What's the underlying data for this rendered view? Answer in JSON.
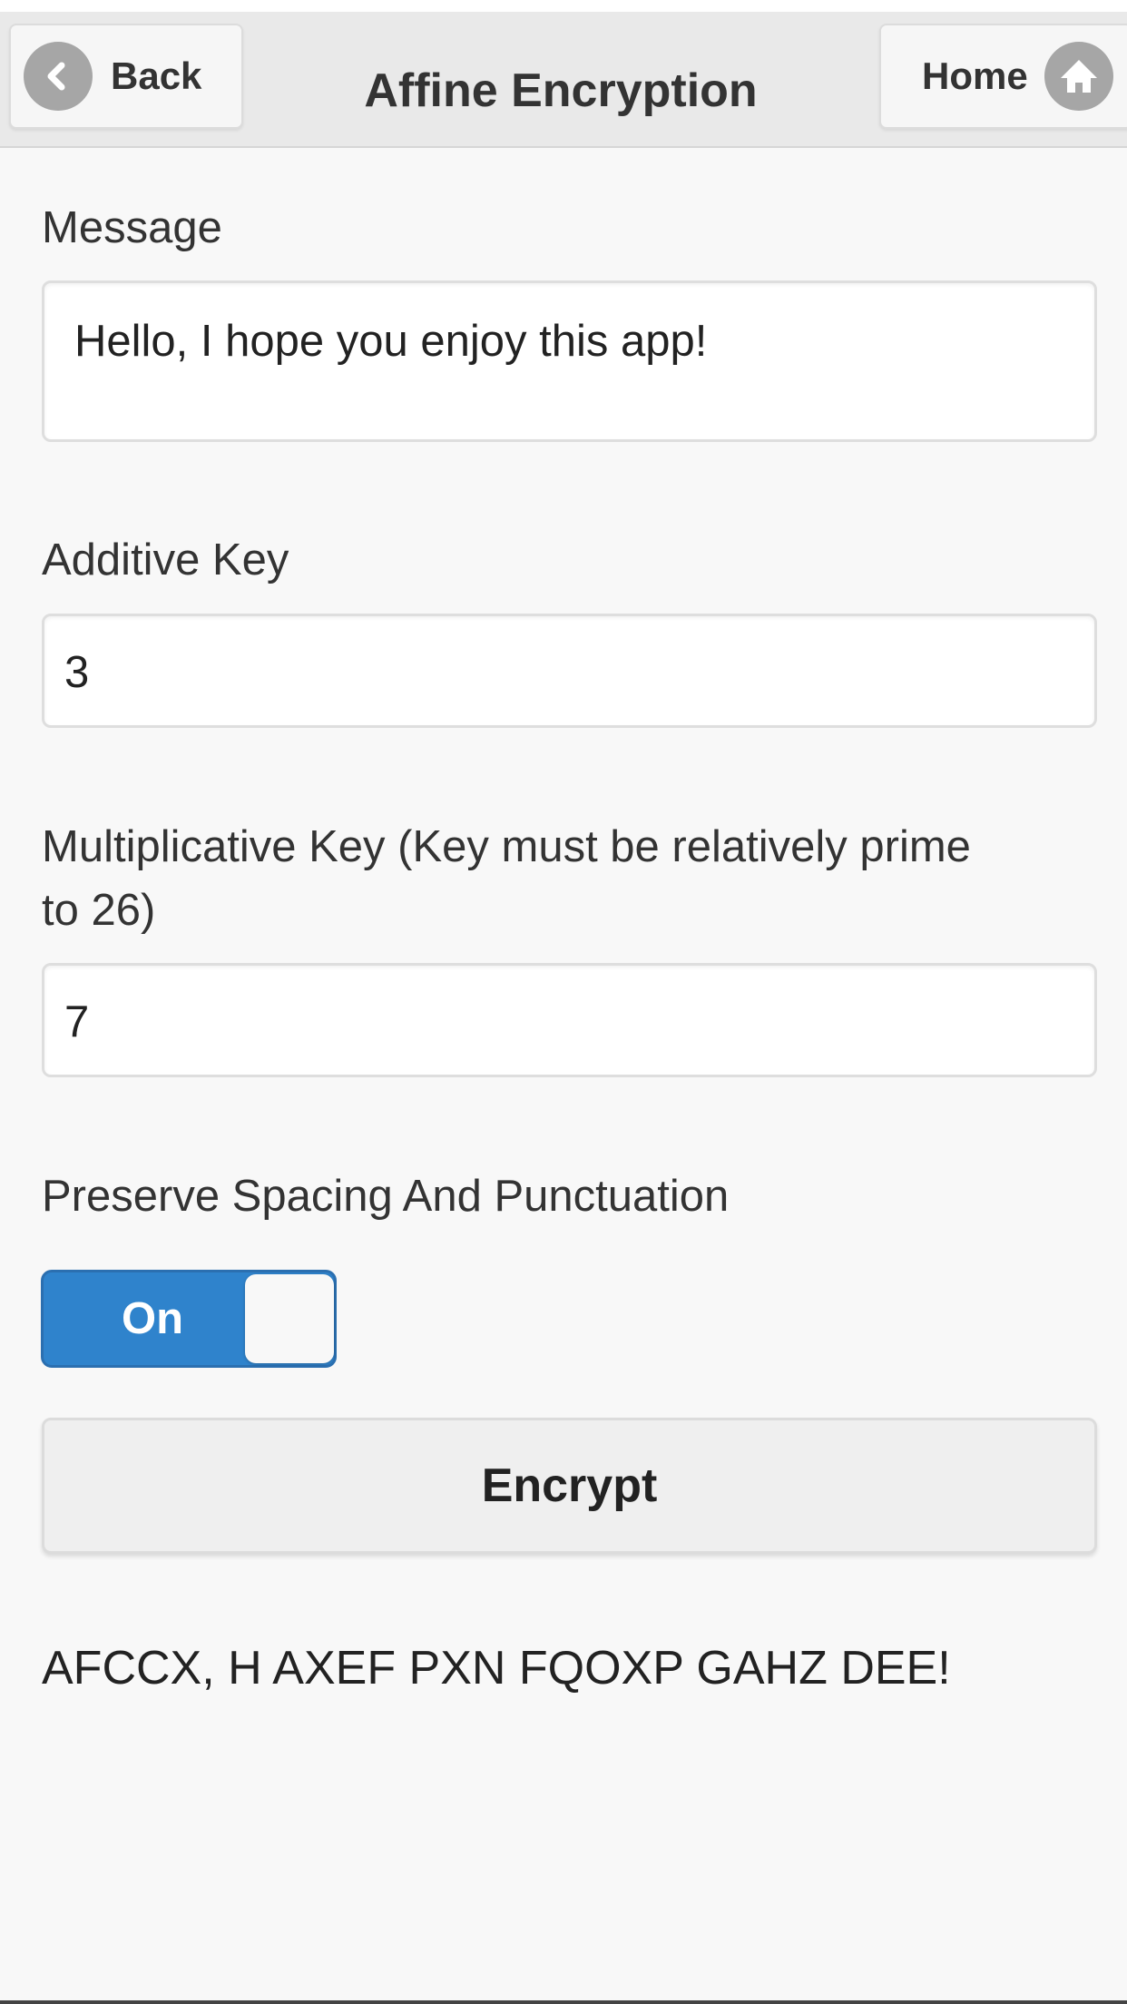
{
  "header": {
    "back_label": "Back",
    "title": "Affine Encryption",
    "home_label": "Home"
  },
  "form": {
    "message_label": "Message",
    "message_value": "Hello, I hope you enjoy this app!",
    "additive_label": "Additive Key",
    "additive_value": "3",
    "multiplicative_label_line1": "Multiplicative Key (Key must be relatively prime",
    "multiplicative_label_line2": "to 26)",
    "multiplicative_value": "7",
    "preserve_label": "Preserve Spacing And Punctuation",
    "toggle_state": "On",
    "encrypt_label": "Encrypt"
  },
  "output": {
    "result": "AFCCX, H AXEF PXN FQOXP GAHZ DEE!"
  },
  "icons": {
    "back": "chevron-left-icon",
    "home": "home-icon"
  },
  "colors": {
    "toggle_on": "#2f83cc",
    "header_bg": "#e9e9e9",
    "page_bg": "#f8f8f8"
  }
}
